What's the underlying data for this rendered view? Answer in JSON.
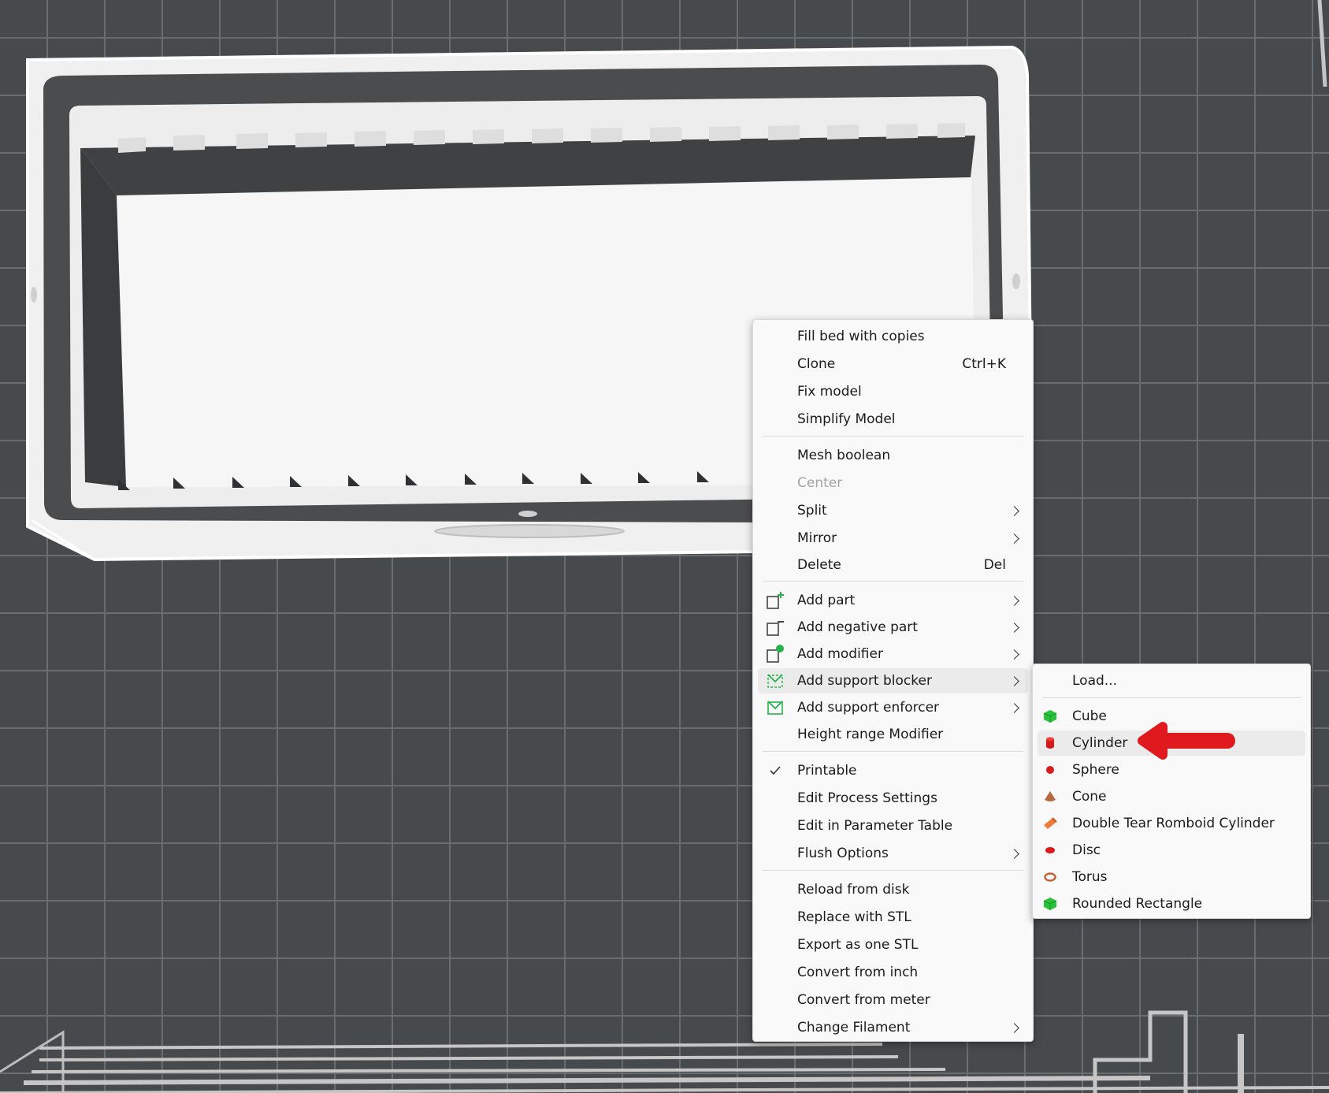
{
  "context_menu": {
    "items": [
      {
        "label": "Fill bed with copies"
      },
      {
        "label": "Clone",
        "shortcut": "Ctrl+K"
      },
      {
        "label": "Fix model"
      },
      {
        "label": "Simplify Model"
      },
      {
        "label": "Mesh boolean"
      },
      {
        "label": "Center"
      },
      {
        "label": "Split"
      },
      {
        "label": "Mirror"
      },
      {
        "label": "Delete",
        "shortcut": "Del"
      },
      {
        "label": "Add part"
      },
      {
        "label": "Add negative part"
      },
      {
        "label": "Add modifier"
      },
      {
        "label": "Add support blocker"
      },
      {
        "label": "Add support enforcer"
      },
      {
        "label": "Height range Modifier"
      },
      {
        "label": "Printable"
      },
      {
        "label": "Edit Process Settings"
      },
      {
        "label": "Edit in Parameter Table"
      },
      {
        "label": "Flush Options"
      },
      {
        "label": "Reload from disk"
      },
      {
        "label": "Replace with STL"
      },
      {
        "label": "Export as one STL"
      },
      {
        "label": "Convert from inch"
      },
      {
        "label": "Convert from meter"
      },
      {
        "label": "Change Filament"
      }
    ]
  },
  "submenu": {
    "items": [
      {
        "label": "Load..."
      },
      {
        "label": "Cube"
      },
      {
        "label": "Cylinder"
      },
      {
        "label": "Sphere"
      },
      {
        "label": "Cone"
      },
      {
        "label": "Double Tear Romboid Cylinder"
      },
      {
        "label": "Disc"
      },
      {
        "label": "Torus"
      },
      {
        "label": "Rounded Rectangle"
      }
    ]
  },
  "colors": {
    "accent_green": "#27b34a",
    "annotation_red": "#e0191f",
    "bed_background": "#474a4c",
    "grid_line": "#6a6d6f"
  }
}
